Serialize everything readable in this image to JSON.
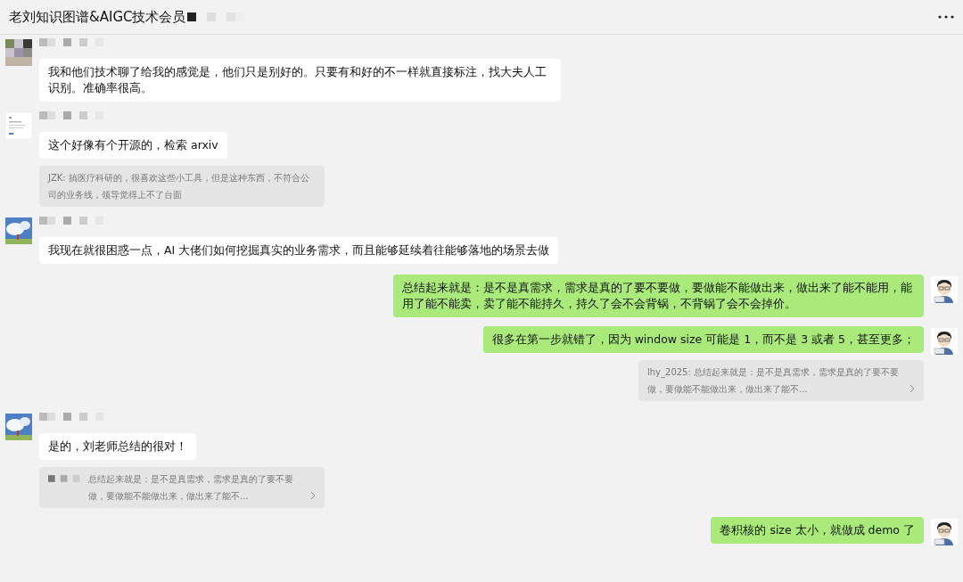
{
  "header": {
    "title": "老刘知识图谱&AIGC技术会员"
  },
  "messages": [
    {
      "kind": "incoming",
      "text": "我和他们技术聊了给我的感觉是，他们只是别好的。只要有和好的不一样就直接标注，找大夫人工识别。准确率很高。"
    },
    {
      "kind": "incoming",
      "text": "这个好像有个开源的，检索 arxiv",
      "quote": {
        "text": "JZK: 搞医疗科研的，很喜欢这些小工具，但是这种东西，不符合公司的业务线，领导觉得上不了台面",
        "sender_masked": false,
        "expandable": false
      }
    },
    {
      "kind": "incoming",
      "text": "我现在就很困惑一点，AI 大佬们如何挖掘真实的业务需求，而且能够延续着往能够落地的场景去做"
    },
    {
      "kind": "outgoing",
      "text": "总结起来就是：是不是真需求，需求是真的了要不要做，要做能不能做出来，做出来了能不能用，能用了能不能卖，卖了能不能持久，持久了会不会背锅，不背锅了会不会掉价。"
    },
    {
      "kind": "outgoing",
      "text": "很多在第一步就错了，因为 window size 可能是 1，而不是 3 或者 5，甚至更多；",
      "quote": {
        "text": "lhy_2025: 总结起来就是：是不是真需求，需求是真的了要不要做，要做能不能做出来，做出来了能不...",
        "sender_masked": false,
        "expandable": true
      }
    },
    {
      "kind": "incoming",
      "text": "是的，刘老师总结的很对！",
      "quote": {
        "text": "总结起来就是：是不是真需求，需求是真的了要不要做，要做能不能做出来，做出来了能不...",
        "sender_masked": true,
        "expandable": true
      }
    },
    {
      "kind": "outgoing",
      "text": "卷积核的 size 太小，就做成 demo 了"
    }
  ]
}
